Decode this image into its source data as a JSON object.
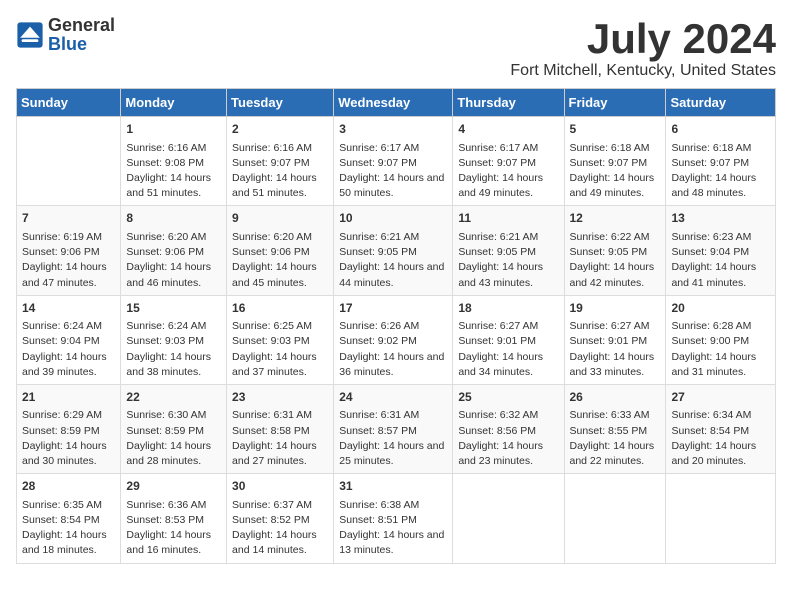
{
  "header": {
    "logo_general": "General",
    "logo_blue": "Blue",
    "title": "July 2024",
    "subtitle": "Fort Mitchell, Kentucky, United States"
  },
  "weekdays": [
    "Sunday",
    "Monday",
    "Tuesday",
    "Wednesday",
    "Thursday",
    "Friday",
    "Saturday"
  ],
  "weeks": [
    [
      {
        "day": "",
        "sunrise": "",
        "sunset": "",
        "daylight": ""
      },
      {
        "day": "1",
        "sunrise": "Sunrise: 6:16 AM",
        "sunset": "Sunset: 9:08 PM",
        "daylight": "Daylight: 14 hours and 51 minutes."
      },
      {
        "day": "2",
        "sunrise": "Sunrise: 6:16 AM",
        "sunset": "Sunset: 9:07 PM",
        "daylight": "Daylight: 14 hours and 51 minutes."
      },
      {
        "day": "3",
        "sunrise": "Sunrise: 6:17 AM",
        "sunset": "Sunset: 9:07 PM",
        "daylight": "Daylight: 14 hours and 50 minutes."
      },
      {
        "day": "4",
        "sunrise": "Sunrise: 6:17 AM",
        "sunset": "Sunset: 9:07 PM",
        "daylight": "Daylight: 14 hours and 49 minutes."
      },
      {
        "day": "5",
        "sunrise": "Sunrise: 6:18 AM",
        "sunset": "Sunset: 9:07 PM",
        "daylight": "Daylight: 14 hours and 49 minutes."
      },
      {
        "day": "6",
        "sunrise": "Sunrise: 6:18 AM",
        "sunset": "Sunset: 9:07 PM",
        "daylight": "Daylight: 14 hours and 48 minutes."
      }
    ],
    [
      {
        "day": "7",
        "sunrise": "Sunrise: 6:19 AM",
        "sunset": "Sunset: 9:06 PM",
        "daylight": "Daylight: 14 hours and 47 minutes."
      },
      {
        "day": "8",
        "sunrise": "Sunrise: 6:20 AM",
        "sunset": "Sunset: 9:06 PM",
        "daylight": "Daylight: 14 hours and 46 minutes."
      },
      {
        "day": "9",
        "sunrise": "Sunrise: 6:20 AM",
        "sunset": "Sunset: 9:06 PM",
        "daylight": "Daylight: 14 hours and 45 minutes."
      },
      {
        "day": "10",
        "sunrise": "Sunrise: 6:21 AM",
        "sunset": "Sunset: 9:05 PM",
        "daylight": "Daylight: 14 hours and 44 minutes."
      },
      {
        "day": "11",
        "sunrise": "Sunrise: 6:21 AM",
        "sunset": "Sunset: 9:05 PM",
        "daylight": "Daylight: 14 hours and 43 minutes."
      },
      {
        "day": "12",
        "sunrise": "Sunrise: 6:22 AM",
        "sunset": "Sunset: 9:05 PM",
        "daylight": "Daylight: 14 hours and 42 minutes."
      },
      {
        "day": "13",
        "sunrise": "Sunrise: 6:23 AM",
        "sunset": "Sunset: 9:04 PM",
        "daylight": "Daylight: 14 hours and 41 minutes."
      }
    ],
    [
      {
        "day": "14",
        "sunrise": "Sunrise: 6:24 AM",
        "sunset": "Sunset: 9:04 PM",
        "daylight": "Daylight: 14 hours and 39 minutes."
      },
      {
        "day": "15",
        "sunrise": "Sunrise: 6:24 AM",
        "sunset": "Sunset: 9:03 PM",
        "daylight": "Daylight: 14 hours and 38 minutes."
      },
      {
        "day": "16",
        "sunrise": "Sunrise: 6:25 AM",
        "sunset": "Sunset: 9:03 PM",
        "daylight": "Daylight: 14 hours and 37 minutes."
      },
      {
        "day": "17",
        "sunrise": "Sunrise: 6:26 AM",
        "sunset": "Sunset: 9:02 PM",
        "daylight": "Daylight: 14 hours and 36 minutes."
      },
      {
        "day": "18",
        "sunrise": "Sunrise: 6:27 AM",
        "sunset": "Sunset: 9:01 PM",
        "daylight": "Daylight: 14 hours and 34 minutes."
      },
      {
        "day": "19",
        "sunrise": "Sunrise: 6:27 AM",
        "sunset": "Sunset: 9:01 PM",
        "daylight": "Daylight: 14 hours and 33 minutes."
      },
      {
        "day": "20",
        "sunrise": "Sunrise: 6:28 AM",
        "sunset": "Sunset: 9:00 PM",
        "daylight": "Daylight: 14 hours and 31 minutes."
      }
    ],
    [
      {
        "day": "21",
        "sunrise": "Sunrise: 6:29 AM",
        "sunset": "Sunset: 8:59 PM",
        "daylight": "Daylight: 14 hours and 30 minutes."
      },
      {
        "day": "22",
        "sunrise": "Sunrise: 6:30 AM",
        "sunset": "Sunset: 8:59 PM",
        "daylight": "Daylight: 14 hours and 28 minutes."
      },
      {
        "day": "23",
        "sunrise": "Sunrise: 6:31 AM",
        "sunset": "Sunset: 8:58 PM",
        "daylight": "Daylight: 14 hours and 27 minutes."
      },
      {
        "day": "24",
        "sunrise": "Sunrise: 6:31 AM",
        "sunset": "Sunset: 8:57 PM",
        "daylight": "Daylight: 14 hours and 25 minutes."
      },
      {
        "day": "25",
        "sunrise": "Sunrise: 6:32 AM",
        "sunset": "Sunset: 8:56 PM",
        "daylight": "Daylight: 14 hours and 23 minutes."
      },
      {
        "day": "26",
        "sunrise": "Sunrise: 6:33 AM",
        "sunset": "Sunset: 8:55 PM",
        "daylight": "Daylight: 14 hours and 22 minutes."
      },
      {
        "day": "27",
        "sunrise": "Sunrise: 6:34 AM",
        "sunset": "Sunset: 8:54 PM",
        "daylight": "Daylight: 14 hours and 20 minutes."
      }
    ],
    [
      {
        "day": "28",
        "sunrise": "Sunrise: 6:35 AM",
        "sunset": "Sunset: 8:54 PM",
        "daylight": "Daylight: 14 hours and 18 minutes."
      },
      {
        "day": "29",
        "sunrise": "Sunrise: 6:36 AM",
        "sunset": "Sunset: 8:53 PM",
        "daylight": "Daylight: 14 hours and 16 minutes."
      },
      {
        "day": "30",
        "sunrise": "Sunrise: 6:37 AM",
        "sunset": "Sunset: 8:52 PM",
        "daylight": "Daylight: 14 hours and 14 minutes."
      },
      {
        "day": "31",
        "sunrise": "Sunrise: 6:38 AM",
        "sunset": "Sunset: 8:51 PM",
        "daylight": "Daylight: 14 hours and 13 minutes."
      },
      {
        "day": "",
        "sunrise": "",
        "sunset": "",
        "daylight": ""
      },
      {
        "day": "",
        "sunrise": "",
        "sunset": "",
        "daylight": ""
      },
      {
        "day": "",
        "sunrise": "",
        "sunset": "",
        "daylight": ""
      }
    ]
  ]
}
